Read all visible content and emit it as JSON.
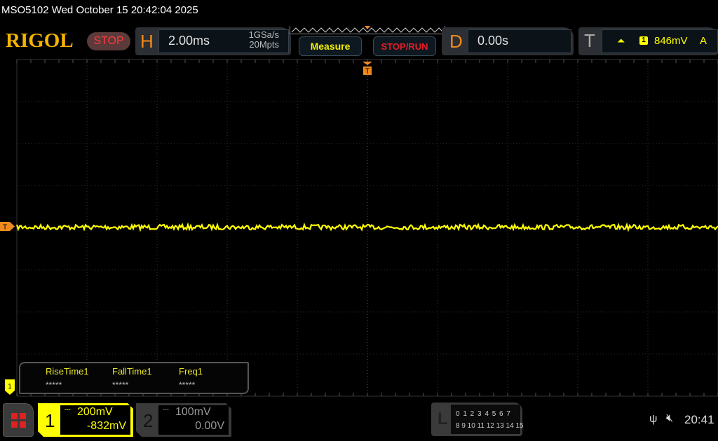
{
  "titlebar": {
    "text": "MSO5102  Wed October 15 20:42:04 2025"
  },
  "header": {
    "logo": "RIGOL",
    "run_state": "STOP",
    "horizontal": {
      "letter": "H",
      "timebase": "2.00ms",
      "sample_rate": "1GSa/s",
      "memory_depth": "20Mpts"
    },
    "measure_button": "Measure",
    "stop_run_button": "STOP/RUN",
    "delay": {
      "letter": "D",
      "value": "0.00s"
    },
    "trigger": {
      "letter": "T",
      "edge_icon": "rising-edge-icon",
      "source": "1",
      "level": "846mV",
      "mode": "A"
    }
  },
  "screen": {
    "grid": {
      "h_divisions": 10,
      "v_divisions": 8
    },
    "trigger_position_marker": "T",
    "trigger_level_marker": "T",
    "channel1_marker": "1",
    "trace": {
      "channel": 1,
      "color": "#ffff00",
      "level_div": 0.0,
      "note_noise": "flat noisy line"
    }
  },
  "measurements": [
    {
      "name": "RiseTime1",
      "value": "*****"
    },
    {
      "name": "FallTime1",
      "value": "*****"
    },
    {
      "name": "Freq1",
      "value": "*****"
    }
  ],
  "channels": [
    {
      "num": "1",
      "scale": "200mV",
      "offset": "-832mV",
      "active": true,
      "color": "#ffff00"
    },
    {
      "num": "2",
      "scale": "100mV",
      "offset": "0.00V",
      "active": false,
      "color": "#888888"
    }
  ],
  "logic": {
    "letter": "L",
    "row1": "0 1 2 3  4 5 6 7",
    "row2": "8 9 10 11 12 13 14 15"
  },
  "status": {
    "usb_icon": "usb-icon",
    "sound_icon": "mute-icon",
    "clock": "20:41"
  }
}
